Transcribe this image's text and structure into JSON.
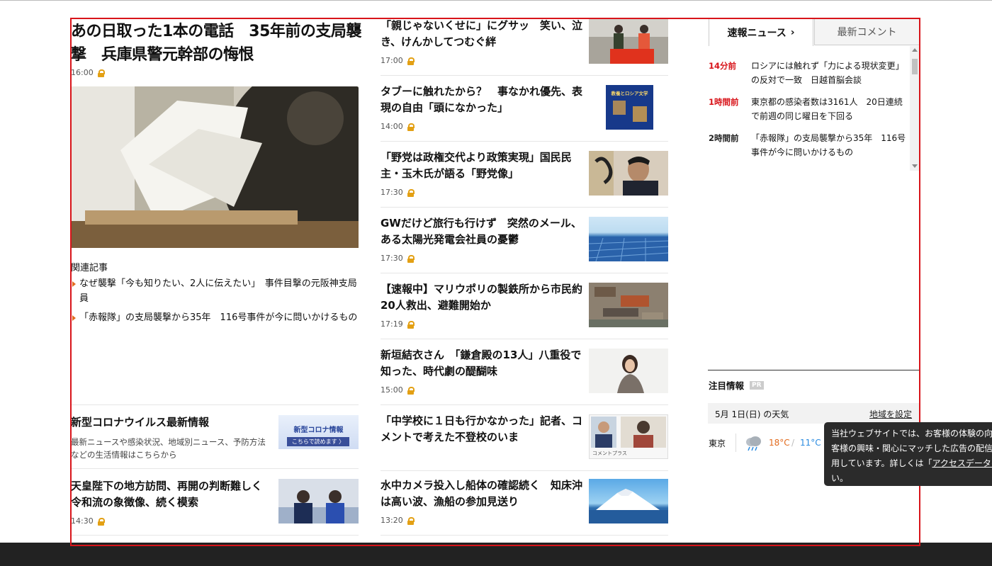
{
  "lead": {
    "title": "あの日取った1本の電話　35年前の支局襲撃　兵庫県警元幹部の悔恨",
    "time": "16:00",
    "related_heading": "関連記事",
    "related": [
      "なぜ襲撃「今も知りたい、2人に伝えたい」　事件目撃の元阪神支局員",
      "「赤報隊」の支局襲撃から35年　116号事件が今に問いかけるもの"
    ]
  },
  "left_cards": [
    {
      "title": "新型コロナウイルス最新情報",
      "desc": "最新ニュースや感染状況、地域別ニュース、予防方法などの生活情報はこちらから",
      "banner_line1": "新型コロナ情報",
      "banner_line2": "こちらで読めます 〉"
    },
    {
      "title": "天皇陛下の地方訪問、再開の判断難しく　令和流の象徴像、続く模索",
      "time": "14:30"
    }
  ],
  "mid_articles": [
    {
      "title": "「親じゃないくせに」にグサッ　笑い、泣き、けんかしてつむぐ絆",
      "time": "17:00"
    },
    {
      "title": "タブーに触れたから？　事なかれ優先、表現の自由「頭になかった」",
      "time": "14:00",
      "thumb_text": "教養とロシア文学"
    },
    {
      "title": "「野党は政権交代より政策実現」国民民主・玉木氏が語る「野党像」",
      "time": "17:30"
    },
    {
      "title": "GWだけど旅行も行けず　突然のメール、ある太陽光発電会社員の憂鬱",
      "time": "17:30"
    },
    {
      "title": "【速報中】マリウポリの製鉄所から市民約20人救出、避難開始か",
      "time": "17:19"
    },
    {
      "title": "新垣結衣さん　「鎌倉殿の13人」八重役で知った、時代劇の醍醐味",
      "time": "15:00"
    },
    {
      "title": "「中学校に１日も行かなかった」記者、コメントで考えた不登校のいま",
      "time": "",
      "thumb_text": "コメントプラス"
    },
    {
      "title": "水中カメラ投入し船体の確認続く　知床沖は高い波、漁船の参加見送り",
      "time": "13:20"
    }
  ],
  "tabs": {
    "breaking": "速報ニュース",
    "comments": "最新コメント"
  },
  "breaking_news": [
    {
      "age": "14分前",
      "text": "ロシアには触れず「力による現状変更」の反対で一致　日越首脳会談",
      "highlight": true
    },
    {
      "age": "1時間前",
      "text": "東京都の感染者数は3161人　20日連続で前週の同じ曜日を下回る",
      "highlight": true
    },
    {
      "age": "2時間前",
      "text": "「赤報隊」の支局襲撃から35年　116号事件が今に問いかけるもの",
      "highlight": false
    }
  ],
  "attention": {
    "label": "注目情報",
    "pr": "PR"
  },
  "weather": {
    "date": "5月 1日(日) の天気",
    "region_link": "地域を設定",
    "city": "東京",
    "high": "18°C",
    "low": "11°C",
    "icon": "rain-cloud-icon"
  },
  "tooltip": {
    "line1": "当社ウェブサイトでは、お客様の体験の向上",
    "line2": "客様の興味・関心にマッチした広告の配信と",
    "line3": "用しています。詳しくは「",
    "link": "アクセスデータの",
    "line4": "い。"
  },
  "colors": {
    "accent": "#d8141a",
    "lock": "#e3a014",
    "high_temp": "#e26b1e",
    "low_temp": "#2a8be0"
  }
}
